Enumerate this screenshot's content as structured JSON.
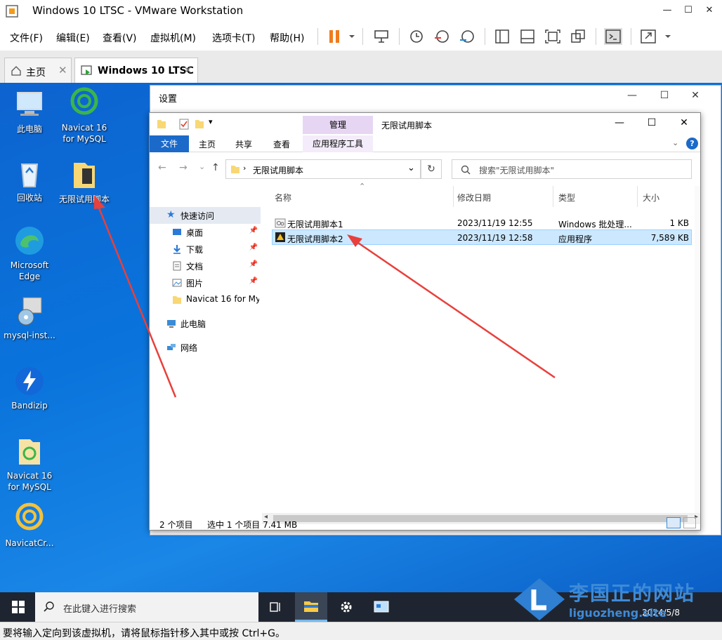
{
  "window": {
    "title": "Windows 10 LTSC - VMware Workstation",
    "min": "—",
    "max": "☐",
    "close": "✕"
  },
  "menu": [
    "文件(F)",
    "编辑(E)",
    "查看(V)",
    "虚拟机(M)",
    "选项卡(T)",
    "帮助(H)"
  ],
  "tabs": [
    {
      "label": "主页"
    },
    {
      "label": "Windows 10 LTSC"
    }
  ],
  "desktop_icons": [
    {
      "label": "此电脑"
    },
    {
      "label": "Navicat 16 for MySQL"
    },
    {
      "label": "回收站"
    },
    {
      "label": "无限试用脚本"
    },
    {
      "label": "Microsoft Edge"
    },
    {
      "label": "mysql-inst..."
    },
    {
      "label": "Bandizip"
    },
    {
      "label": "Navicat 16 for MySQL"
    },
    {
      "label": "NavicatCr..."
    }
  ],
  "settings": {
    "title": "设置"
  },
  "explorer": {
    "context_tab": "管理",
    "title": "无限试用脚本",
    "ribbon": {
      "file": "文件",
      "home": "主页",
      "share": "共享",
      "view": "查看",
      "context": "应用程序工具"
    },
    "address": "无限试用脚本",
    "search_placeholder": "搜索\"无限试用脚本\"",
    "nav": [
      {
        "label": "快速访问"
      },
      {
        "label": "桌面"
      },
      {
        "label": "下载"
      },
      {
        "label": "文档"
      },
      {
        "label": "图片"
      },
      {
        "label": "Navicat 16 for My"
      },
      {
        "label": "此电脑"
      },
      {
        "label": "网络"
      }
    ],
    "columns": {
      "name": "名称",
      "date": "修改日期",
      "type": "类型",
      "size": "大小"
    },
    "files": [
      {
        "name": "无限试用脚本1",
        "date": "2023/11/19 12:55",
        "type": "Windows 批处理...",
        "size": "1 KB"
      },
      {
        "name": "无限试用脚本2",
        "date": "2023/11/19 12:58",
        "type": "应用程序",
        "size": "7,589 KB"
      }
    ],
    "status": {
      "count": "2 个项目",
      "selected": "选中 1 个项目  7.41 MB"
    }
  },
  "taskbar": {
    "search_placeholder": "在此键入进行搜索",
    "date": "2024/5/8"
  },
  "watermark": {
    "text": "李国正的网站",
    "url": "liguozheng.site"
  },
  "vm_status": "要将输入定向到该虚拟机，请将鼠标指针移入其中或按 Ctrl+G。",
  "colors": {
    "accent": "#1b6ac9",
    "desktop": "#0a74dc",
    "selection": "#cce8ff",
    "arrow": "#e8403c"
  }
}
